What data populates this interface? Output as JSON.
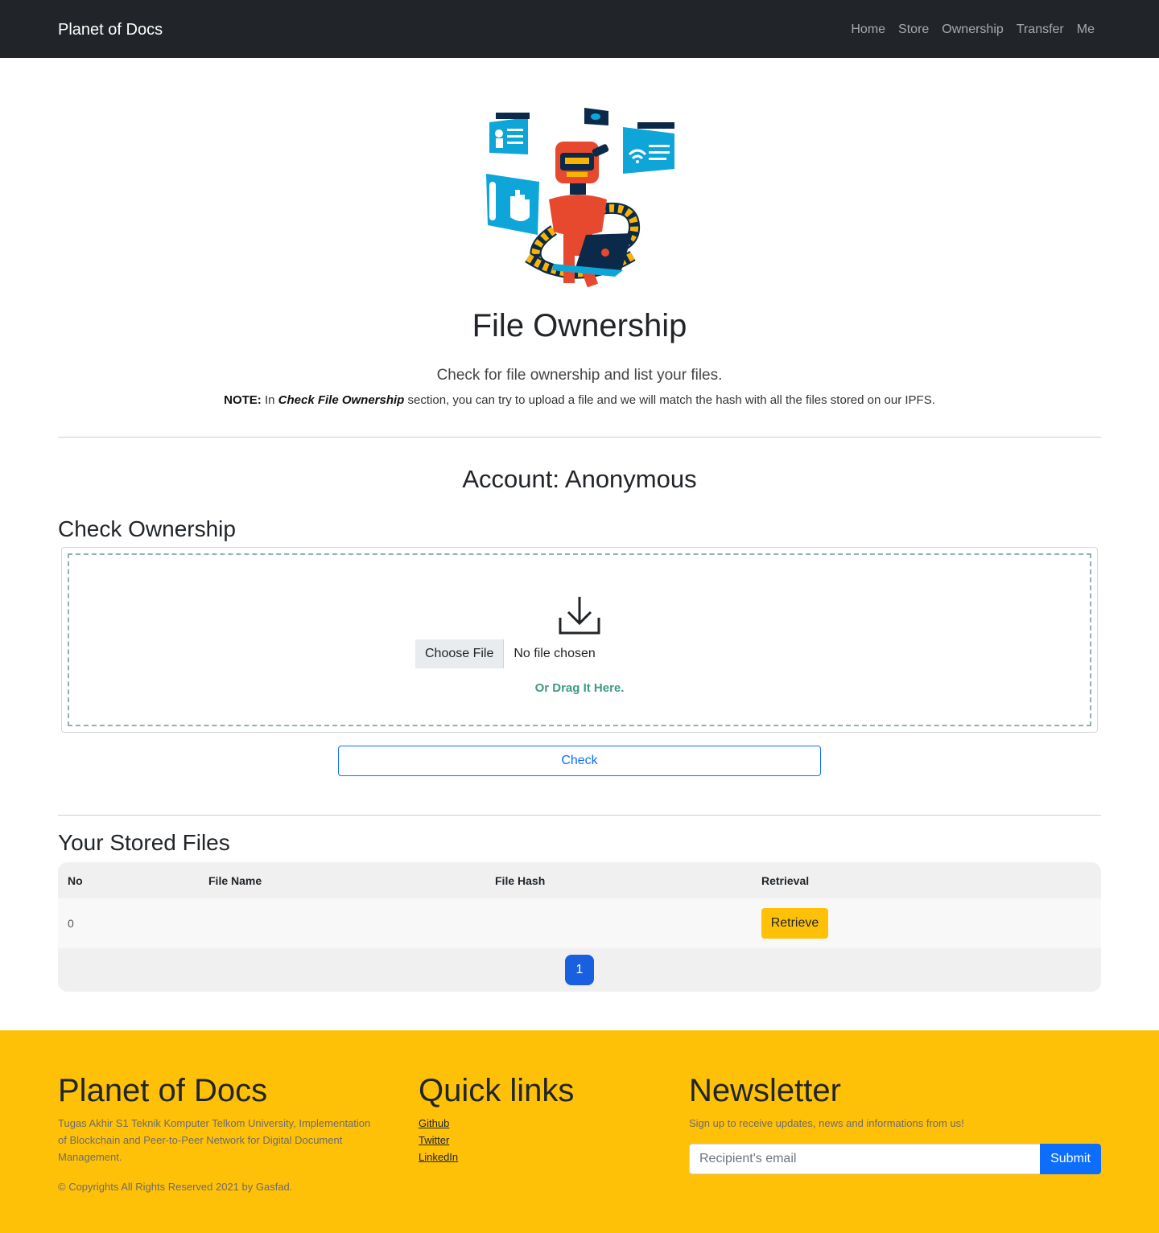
{
  "navbar": {
    "brand": "Planet of Docs",
    "links": [
      "Home",
      "Store",
      "Ownership",
      "Transfer",
      "Me"
    ]
  },
  "hero": {
    "image_icon": "robot-laptop-illustration",
    "title": "File Ownership",
    "lead": "Check for file ownership and list your files.",
    "note_label": "NOTE:",
    "note_prefix": " In ",
    "note_emphasis": "Check File Ownership",
    "note_suffix": " section, you can try to upload a file and we will match the hash with all the files stored on our IPFS."
  },
  "account": {
    "text": "Account: Anonymous"
  },
  "check": {
    "heading": "Check Ownership",
    "upload_icon": "download-icon",
    "choose_label": "Choose File",
    "no_file_label": "No file chosen",
    "drag_text": "Or Drag It Here.",
    "check_button": "Check"
  },
  "stored": {
    "heading": "Your Stored Files",
    "columns": [
      "No",
      "File Name",
      "File Hash",
      "Retrieval"
    ],
    "rows": [
      {
        "no": "0",
        "file_name": "",
        "file_hash": "",
        "retrieval_label": "Retrieve"
      }
    ],
    "pagination": [
      "1"
    ]
  },
  "footer": {
    "brand": {
      "title": "Planet of Docs",
      "description": "Tugas Akhir S1 Teknik Komputer Telkom University, Implementation of Blockchain and Peer-to-Peer Network for Digital Document Management.",
      "copyright": "© Copyrights All Rights Reserved 2021 by Gasfad."
    },
    "quick_links": {
      "title": "Quick links",
      "links": [
        "Github",
        "Twitter",
        "LinkedIn"
      ]
    },
    "newsletter": {
      "title": "Newsletter",
      "text": "Sign up to receive updates, news and informations from us!",
      "placeholder": "Recipient's email",
      "submit_label": "Submit"
    }
  },
  "colors": {
    "navbar": "#212529",
    "primary": "#0d6efd",
    "warning": "#ffc107",
    "drag_text": "#3d9a84"
  }
}
